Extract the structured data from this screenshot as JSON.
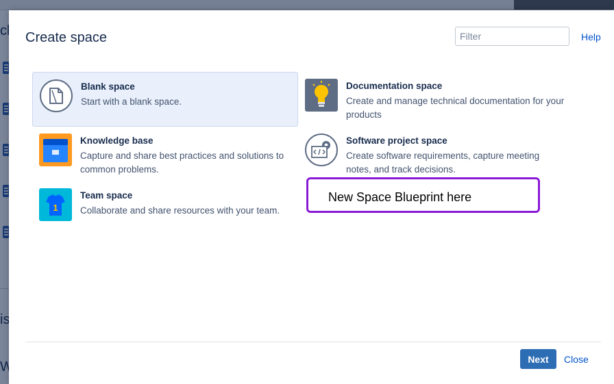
{
  "background": {
    "fragments": [
      "cl",
      "is",
      "W"
    ]
  },
  "dialog": {
    "title": "Create space",
    "filter_placeholder": "Filter",
    "help_label": "Help",
    "next_label": "Next",
    "close_label": "Close"
  },
  "templates": [
    {
      "name": "Blank space",
      "description": "Start with a blank space.",
      "icon": "blank-page-icon",
      "selected": true
    },
    {
      "name": "Documentation space",
      "description": "Create and manage technical documentation for your products",
      "icon": "lightbulb-icon",
      "selected": false
    },
    {
      "name": "Knowledge base",
      "description": "Capture and share best practices and solutions to common problems.",
      "icon": "knowledge-folder-icon",
      "selected": false
    },
    {
      "name": "Software project space",
      "description": "Create software requirements, capture meeting notes, and track decisions.",
      "icon": "code-gear-icon",
      "selected": false
    },
    {
      "name": "Team space",
      "description": "Collaborate and share resources with your team.",
      "icon": "team-jersey-icon",
      "selected": false
    }
  ],
  "annotation": {
    "text": "New Space Blueprint here",
    "color": "#8a19d6"
  },
  "colors": {
    "primary_button": "#2d6db3",
    "link": "#0052cc",
    "selected_tile": "#e9f0fb"
  }
}
